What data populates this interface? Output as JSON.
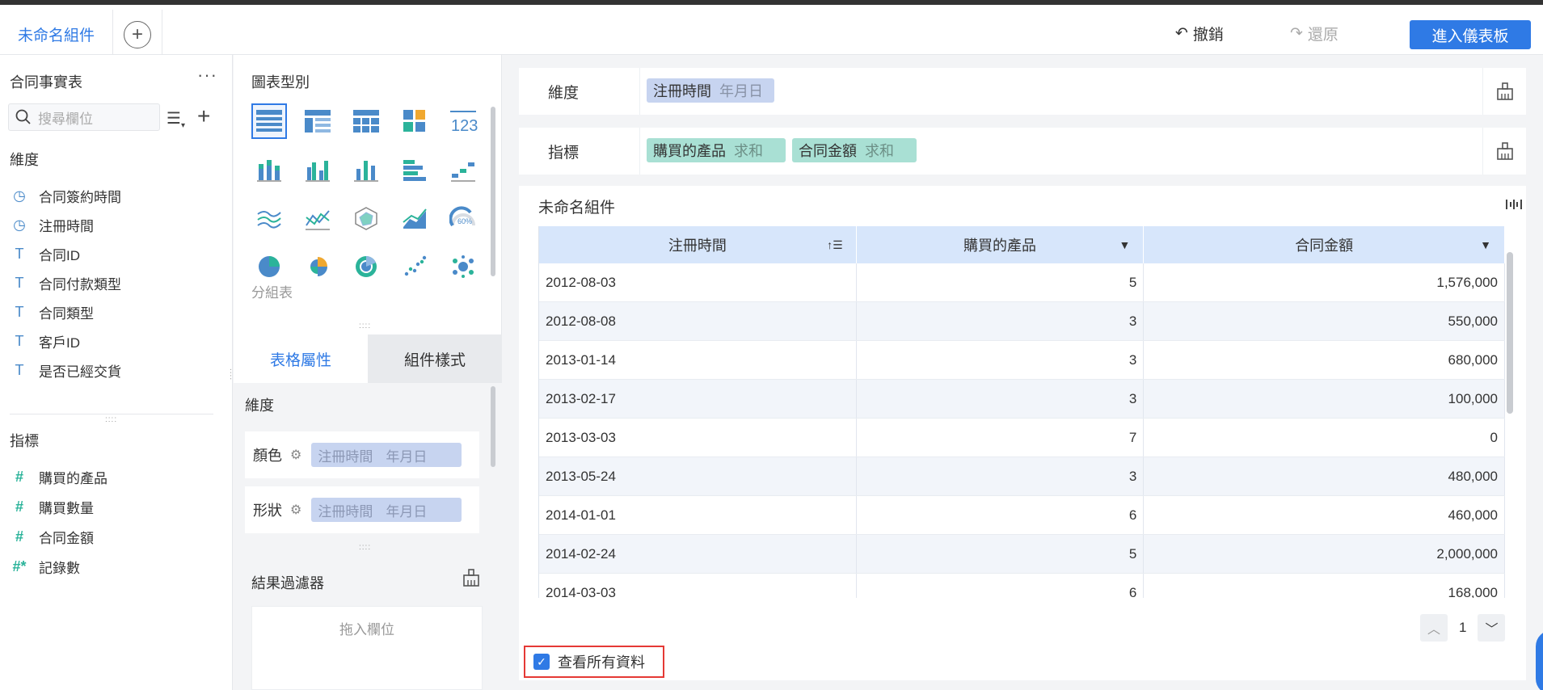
{
  "header": {
    "active_tab": "未命名組件",
    "add_tab": "+",
    "undo_label": "撤銷",
    "redo_label": "還原",
    "enter_dashboard": "進入儀表板"
  },
  "left_panel": {
    "dataset_title": "合同事實表",
    "more": "···",
    "search_placeholder": "搜尋欄位",
    "dimension_label": "維度",
    "dimensions": [
      {
        "label": "合同簽約時間",
        "type": "time"
      },
      {
        "label": "注冊時間",
        "type": "time"
      },
      {
        "label": "合同ID",
        "type": "text"
      },
      {
        "label": "合同付款類型",
        "type": "text"
      },
      {
        "label": "合同類型",
        "type": "text"
      },
      {
        "label": "客戶ID",
        "type": "text"
      },
      {
        "label": "是否已經交貨",
        "type": "text"
      }
    ],
    "metric_label": "指標",
    "metrics": [
      {
        "label": "購買的產品",
        "type": "number"
      },
      {
        "label": "購買數量",
        "type": "number"
      },
      {
        "label": "合同金額",
        "type": "number"
      },
      {
        "label": "記錄數",
        "type": "number-derived"
      }
    ]
  },
  "middle_panel": {
    "chart_type_title": "圖表型別",
    "group_table_label": "分組表",
    "tabs": [
      "表格屬性",
      "組件樣式"
    ],
    "dimension_label": "維度",
    "color_label": "顏色",
    "shape_label": "形狀",
    "color_chip": {
      "field": "注冊時間",
      "granularity": "年月日"
    },
    "shape_chip": {
      "field": "注冊時間",
      "granularity": "年月日"
    },
    "filter_title": "結果過濾器",
    "drop_placeholder": "拖入欄位"
  },
  "right_panel": {
    "dimension_shelf_label": "維度",
    "dimension_chip": {
      "field": "注冊時間",
      "granularity": "年月日"
    },
    "metric_shelf_label": "指標",
    "metric_chips": [
      {
        "field": "購買的產品",
        "agg": "求和"
      },
      {
        "field": "合同金額",
        "agg": "求和"
      }
    ],
    "widget_title": "未命名組件",
    "table": {
      "columns": [
        "注冊時間",
        "購買的產品",
        "合同金額"
      ],
      "rows": [
        [
          "2012-08-03",
          "5",
          "1,576,000"
        ],
        [
          "2012-08-08",
          "3",
          "550,000"
        ],
        [
          "2013-01-14",
          "3",
          "680,000"
        ],
        [
          "2013-02-17",
          "3",
          "100,000"
        ],
        [
          "2013-03-03",
          "7",
          "0"
        ],
        [
          "2013-05-24",
          "3",
          "480,000"
        ],
        [
          "2014-01-01",
          "6",
          "460,000"
        ],
        [
          "2014-02-24",
          "5",
          "2,000,000"
        ],
        [
          "2014-03-03",
          "6",
          "168,000"
        ]
      ]
    },
    "page_number": "1",
    "view_all_label": "查看所有資料",
    "view_all_checked": true
  },
  "colors": {
    "accent": "#2f7ae5",
    "dimension_chip": "#c7d4f0",
    "metric_chip": "#a9e0d4",
    "header_row": "#d7e6fb",
    "highlight_border": "#e53935"
  }
}
